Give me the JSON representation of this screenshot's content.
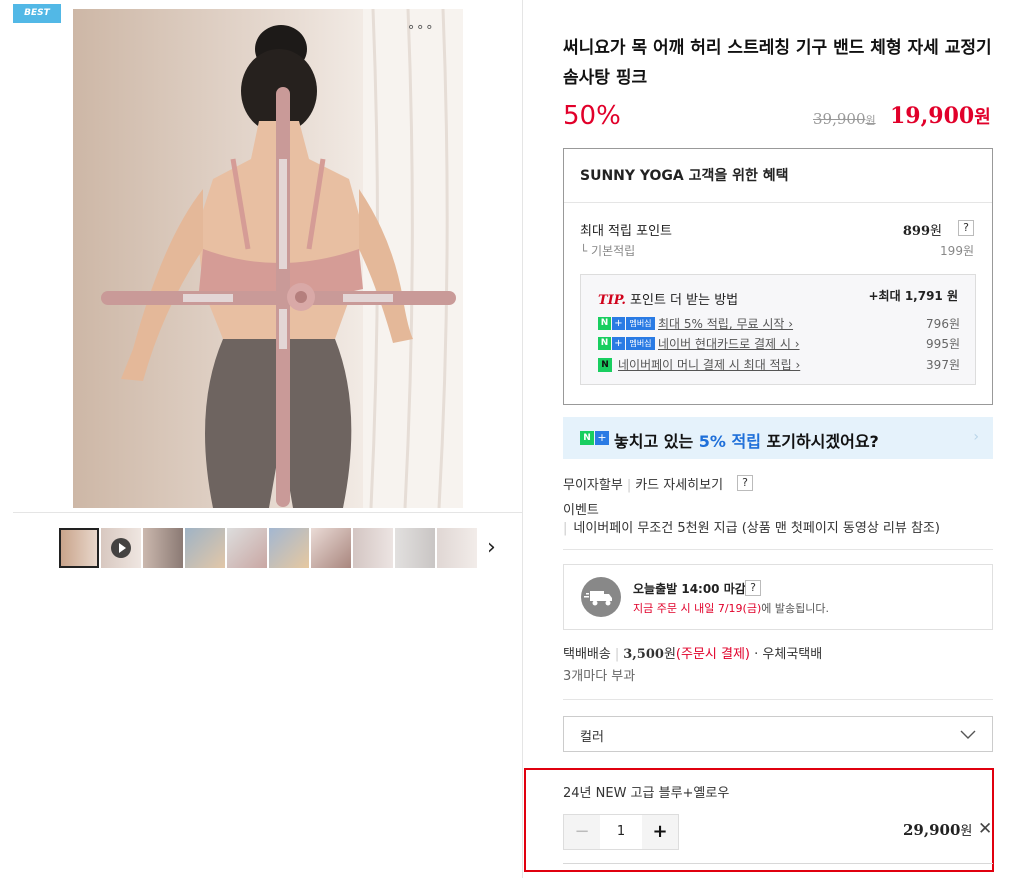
{
  "product": {
    "badge": "BEST",
    "title": "써니요가 목 어깨 허리 스트레칭 기구 밴드 체형 자세 교정기 솜사탕 핑크",
    "more_menu": "∘∘∘"
  },
  "price": {
    "discount": "50%",
    "original": "39,900",
    "original_unit": "원",
    "sale": "19,900",
    "sale_unit": "원"
  },
  "benefit": {
    "title": "SUNNY YOGA 고객을 위한 혜택",
    "max_point_label": "최대 적립 포인트",
    "max_point_value": "899",
    "max_point_unit": "원",
    "base_label": "└ 기본적립",
    "base_value": "199원",
    "tip_prefix": "TIP.",
    "tip_label": "포인트 더 받는 방법",
    "tip_max": "+최대 1,791 원",
    "tips": [
      {
        "text": "최대 5% 적립, 무료 시작 ›",
        "amount": "796원",
        "badge": "멤버십"
      },
      {
        "text": "네이버 현대카드로 결제 시 ›",
        "amount": "995원",
        "badge": "멤버십"
      },
      {
        "text": "네이버페이 머니 결제 시 최대 적립 ›",
        "amount": "397원",
        "badge": "N"
      }
    ]
  },
  "banner": {
    "text_before": "놓치고 있는 ",
    "text_highlight": "5% 적립",
    "text_after": " 포기하시겠어요?",
    "arrow": "›"
  },
  "installment": {
    "label": "무이자할부",
    "card_link": "카드 자세히보기",
    "help": "?"
  },
  "event": {
    "label": "이벤트",
    "text": "네이버페이 무조건 5천원 지급 (상품 맨 첫페이지 동영상 리뷰 참조)"
  },
  "shipping": {
    "title": "오늘출발 14:00 마감",
    "help": "?",
    "sub_highlight": "지금 주문 시 내일 7/19(금)",
    "sub_rest": "에 발송됩니다."
  },
  "delivery": {
    "method": "택배배송",
    "fee": "3,500",
    "fee_unit": "원",
    "fee_note": "(주문시 결제)",
    "carrier": "· 우체국택배",
    "bundle": "3개마다 부과"
  },
  "option_select": {
    "label": "컬러"
  },
  "selected_option": {
    "name": "24년 NEW 고급 블루+옐로우",
    "minus": "−",
    "quantity": "1",
    "plus": "+",
    "price": "29,900",
    "price_unit": "원",
    "close": "✕"
  },
  "gallery": {
    "next": "›",
    "colors": {
      "accent_red": "#e1002a",
      "naver_green": "#19ce60",
      "membership_blue": "#2a7be4",
      "badge_blue": "#52b8e6"
    }
  }
}
